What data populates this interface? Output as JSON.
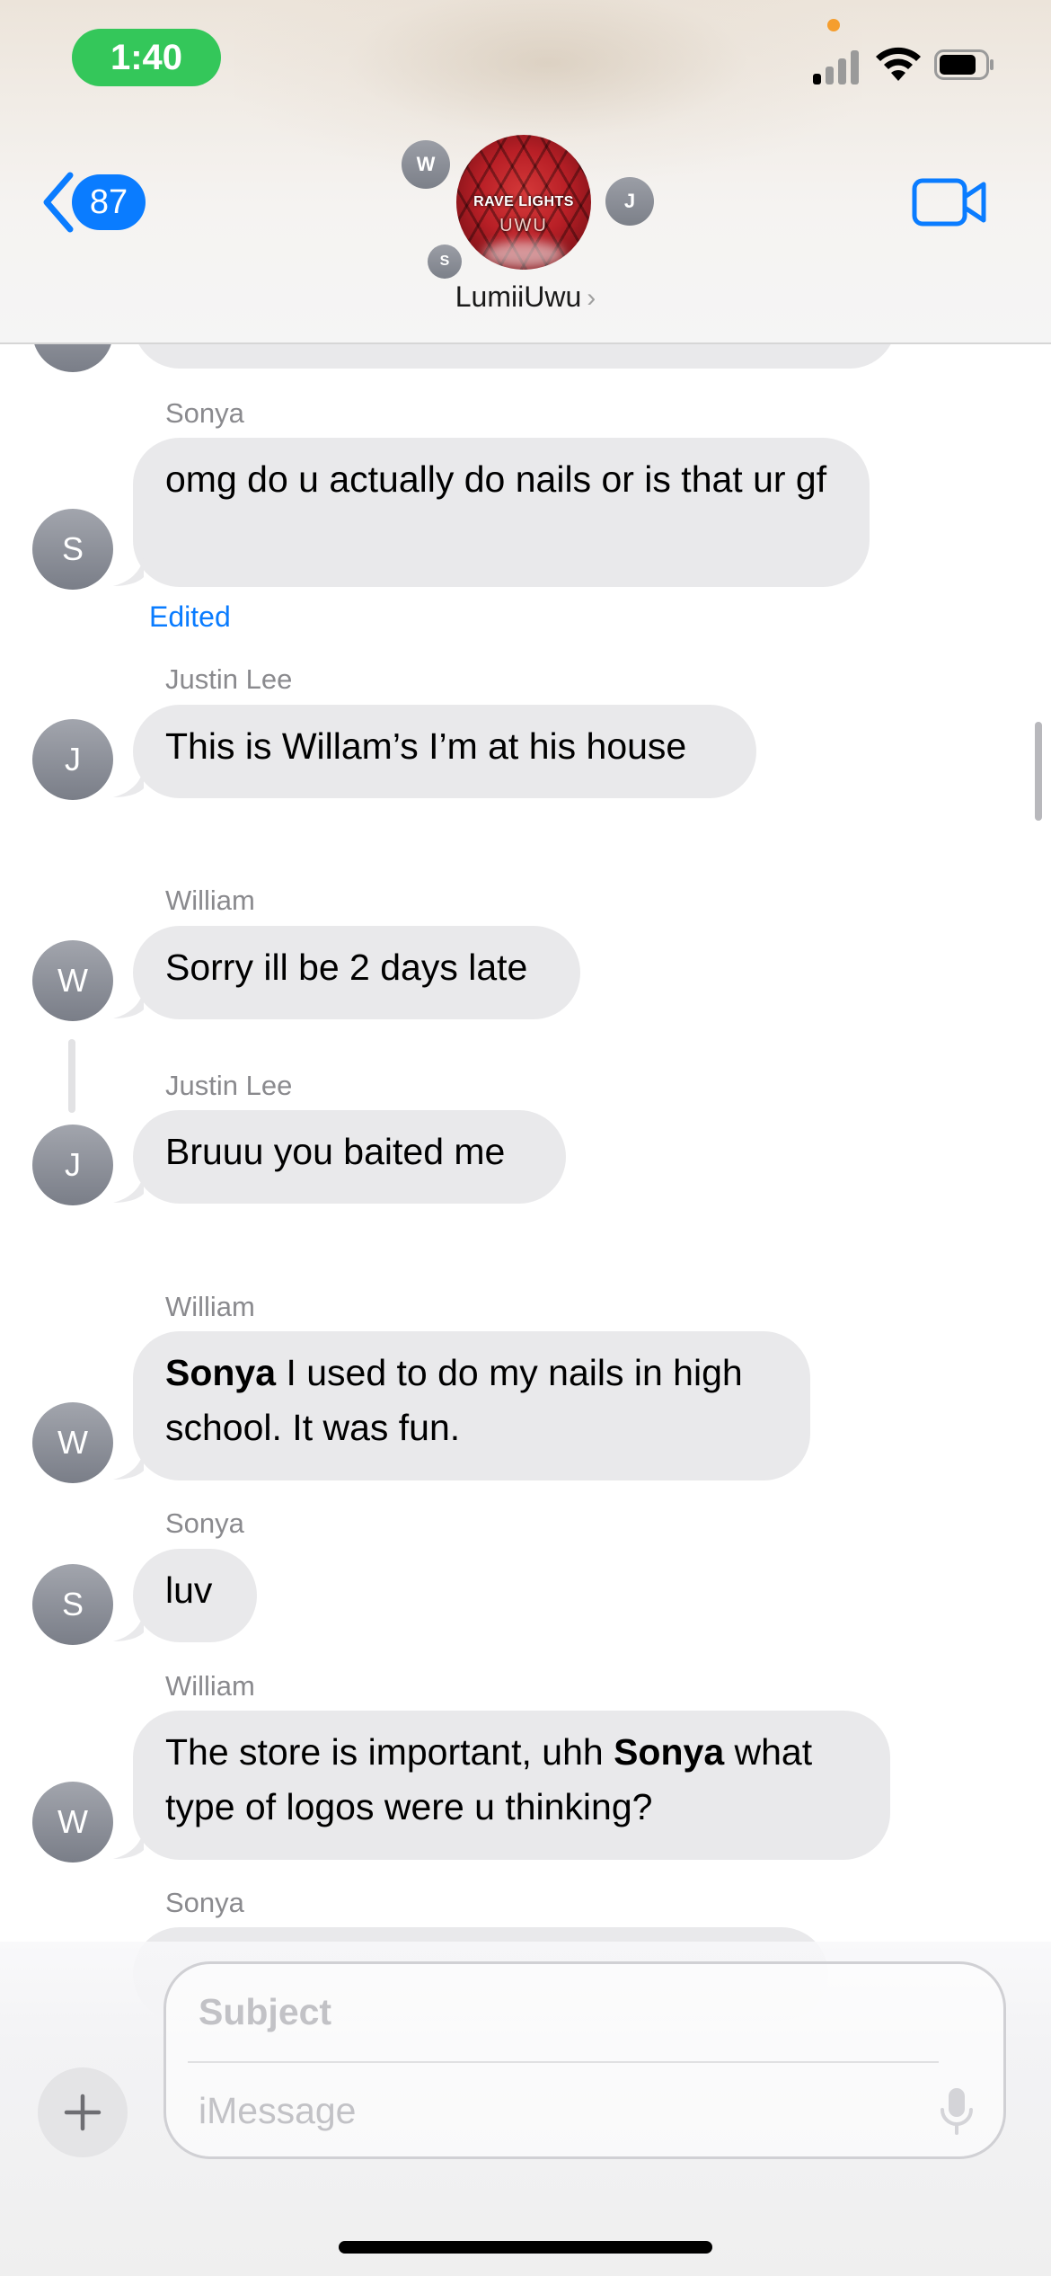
{
  "status_bar": {
    "time": "1:40"
  },
  "header": {
    "back_count": "87",
    "group_name": "LumiiUwu",
    "group_photo_text_line1": "RAVE LIGHTS",
    "group_photo_text_line2": "UWU",
    "member_initials": [
      "W",
      "J",
      "S"
    ]
  },
  "messages": [
    {
      "sender": "Sonya",
      "initial": "S",
      "text": "omg do u actually do nails or is that ur gf",
      "edited_label": "Edited"
    },
    {
      "sender": "Justin Lee",
      "initial": "J",
      "text": "This is Willam’s I’m at his house"
    },
    {
      "sender": "William",
      "initial": "W",
      "text": "Sorry ill be 2 days late"
    },
    {
      "sender": "Justin Lee",
      "initial": "J",
      "text": "Bruuu you baited me"
    },
    {
      "sender": "William",
      "initial": "W",
      "mention": "Sonya",
      "text": " I used to do my nails in high school. It was fun."
    },
    {
      "sender": "Sonya",
      "initial": "S",
      "text": "luv"
    },
    {
      "sender": "William",
      "initial": "W",
      "text_before": "The store is important, uhh ",
      "mention": "Sonya",
      "text_after": " what type of logos were u thinking?"
    },
    {
      "sender": "Sonya"
    }
  ],
  "composer": {
    "subject_placeholder": "Subject",
    "message_placeholder": "iMessage"
  },
  "icons": [
    "back-chevron-icon",
    "video-camera-icon",
    "plus-icon",
    "microphone-icon",
    "signal-icon",
    "wifi-icon",
    "battery-icon"
  ],
  "colors": {
    "accent": "#0a7cff",
    "bubble": "#e9e9eb",
    "time_pill": "#34c75a"
  }
}
